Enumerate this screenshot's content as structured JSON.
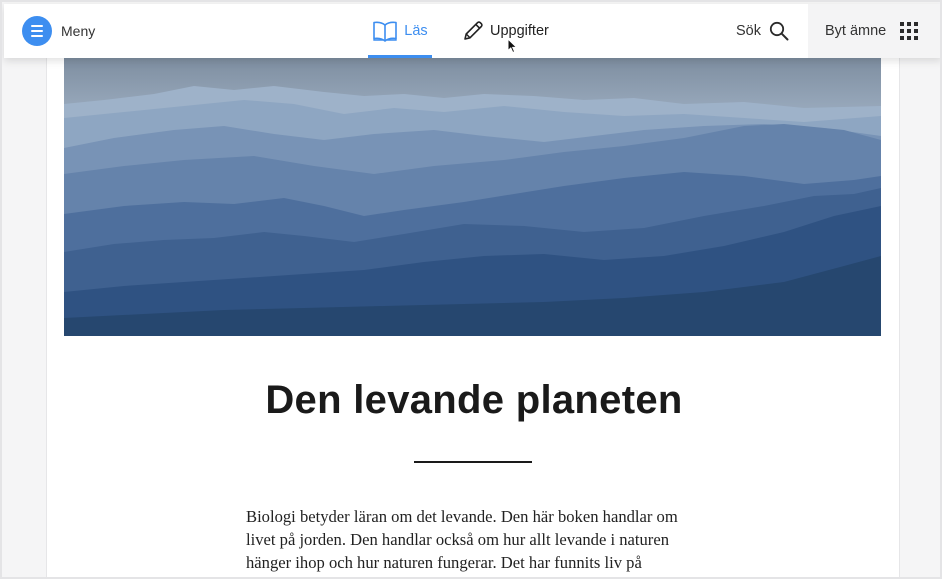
{
  "topbar": {
    "menu_label": "Meny",
    "tab_read_label": "Läs",
    "tab_tasks_label": "Uppgifter",
    "search_label": "Sök",
    "subject_label": "Byt ämne",
    "active_tab": "Läs",
    "accent_color": "#3d8ef0"
  },
  "article": {
    "title": "Den levande planeten",
    "paragraph_lines": [
      "Biologi betyder läran om det levande. Den här boken handlar om",
      "livet på jorden. Den handlar också om hur allt levande i naturen",
      "hänger ihop och hur naturen fungerar. Det har funnits liv på"
    ]
  }
}
